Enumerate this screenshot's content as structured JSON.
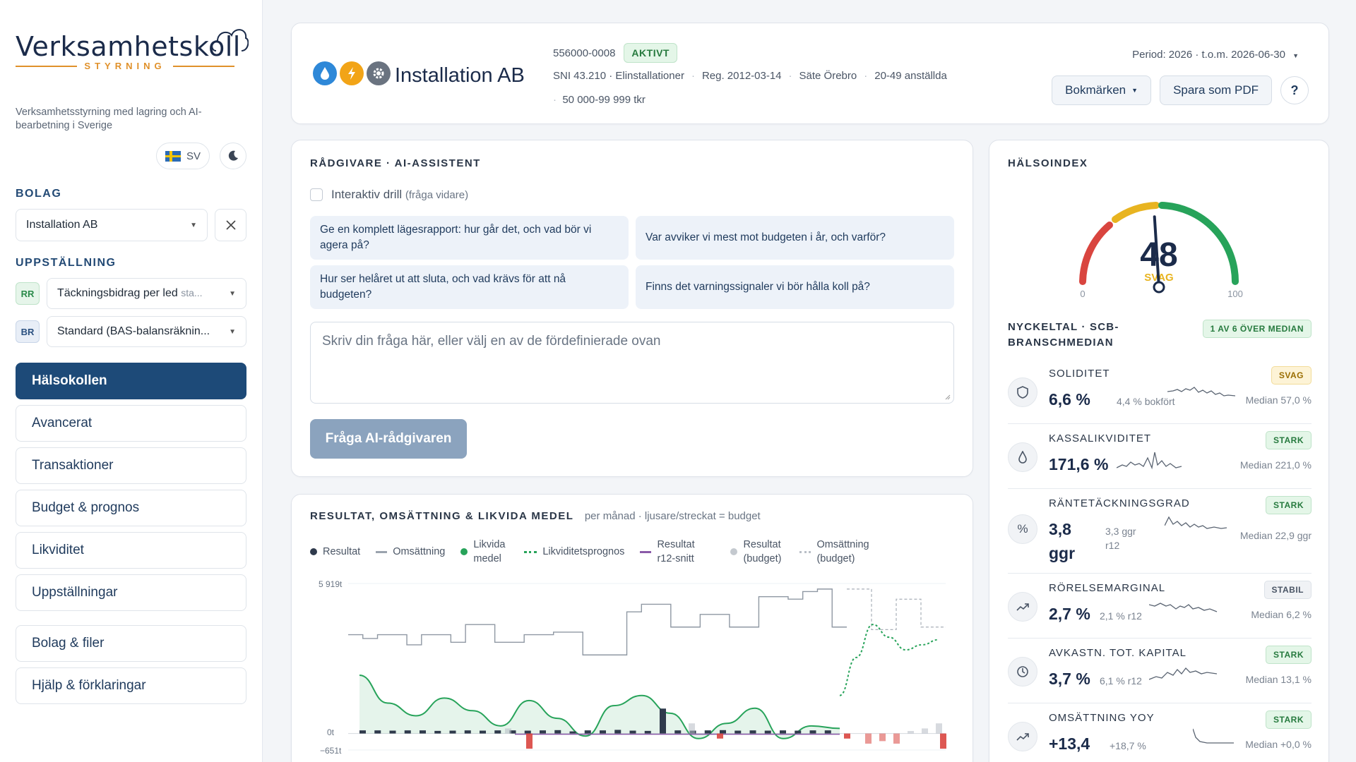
{
  "brand": {
    "name": "Verksamhetskoll",
    "sub": "STYRNING",
    "tagline": "Verksamhetsstyrning med lagring och AI-bearbetning i Sverige"
  },
  "lang": {
    "code": "SV"
  },
  "sidebar": {
    "bolag_heading": "BOLAG",
    "bolag_value": "Installation AB",
    "upp_heading": "UPPSTÄLLNING",
    "rr_tag": "RR",
    "rr_value": "Täckningsbidrag per led",
    "rr_hint": "sta...",
    "br_tag": "BR",
    "br_value": "Standard (BAS-balansräknin...",
    "nav": [
      "Hälsokollen",
      "Avancerat",
      "Transaktioner",
      "Budget & prognos",
      "Likviditet",
      "Uppställningar",
      "Bolag & filer",
      "Hjälp & förklaringar"
    ]
  },
  "header": {
    "company": "Installation AB",
    "orgnr": "556000-0008",
    "status": "AKTIVT",
    "sni": "SNI 43.210 · Elinstallationer",
    "reg": "Reg. 2012-03-14",
    "sate": "Säte Örebro",
    "anstallda": "20-49 anställda",
    "omsattning": "50 000-99 999 tkr",
    "period": "Period: 2026 · t.o.m. 2026-06-30",
    "bokmarken": "Bokmärken",
    "pdf": "Spara som PDF",
    "help": "?"
  },
  "ai": {
    "title": "RÅDGIVARE · AI-ASSISTENT",
    "drill": "Interaktiv drill",
    "drill_sub": "(fråga vidare)",
    "questions": [
      "Ge en komplett lägesrapport: hur går det, och vad bör vi agera på?",
      "Var avviker vi mest mot budgeten i år, och varför?",
      "Hur ser helåret ut att sluta, och vad krävs för att nå budgeten?",
      "Finns det varningssignaler vi bör hålla koll på?"
    ],
    "placeholder": "Skriv din fråga här, eller välj en av de fördefinierade ovan",
    "button": "Fråga AI-rådgivaren"
  },
  "chart": {
    "title": "RESULTAT, OMSÄTTNING & LIKVIDA MEDEL",
    "subtitle": "per månad · ljusare/streckat = budget",
    "legend": [
      "Resultat",
      "Omsättning",
      "Likvida medel",
      "Likviditetsprognos",
      "Resultat r12-snitt",
      "Resultat (budget)",
      "Omsättning (budget)"
    ],
    "y_top": "5 919t",
    "y_zero": "0t",
    "y_bottom": "−651t"
  },
  "chart_data": {
    "type": "line",
    "ylim": [
      -651,
      5919
    ],
    "yticks": [
      "5 919t",
      "0t",
      "−651t"
    ],
    "series": [
      {
        "name": "Omsättning",
        "values": [
          3900,
          3750,
          3900,
          3900,
          3500,
          3900,
          3900,
          3600,
          4300,
          4300,
          3600,
          3600,
          3900,
          3900,
          4000,
          4000,
          3100,
          3100,
          3100,
          4800,
          5100,
          5100,
          4200,
          4200,
          4700,
          4700,
          4200,
          4200,
          5400,
          5400,
          5300,
          5600,
          5700,
          4200
        ]
      },
      {
        "name": "Omsättning (budget)",
        "values": [
          5700,
          5700,
          4100,
          4100,
          5300,
          5300,
          4200,
          4200
        ]
      },
      {
        "name": "Likvida medel",
        "values": [
          2300,
          1200,
          700,
          1400,
          900,
          300,
          1300,
          600,
          -100,
          1100,
          1500,
          800,
          -200,
          400,
          1000,
          -200,
          300,
          200
        ]
      },
      {
        "name": "Likviditetsprognos",
        "values": [
          1500,
          3000,
          4300,
          3800,
          3300,
          3500,
          3700
        ]
      },
      {
        "name": "Resultat",
        "values": [
          40,
          40,
          30,
          40,
          40,
          20,
          30,
          40,
          30,
          40,
          40,
          30,
          40,
          50,
          0,
          40,
          40,
          60,
          30,
          20,
          900,
          40,
          30,
          40,
          50,
          30,
          40,
          30,
          40,
          30,
          40,
          40
        ]
      },
      {
        "name": "Resultat (budget)",
        "values": [
          -600,
          -200,
          -200,
          -400,
          -300,
          -400,
          100,
          200,
          400,
          200,
          400,
          -600
        ]
      }
    ]
  },
  "health": {
    "title": "HÄLSOINDEX",
    "score": "48",
    "label": "SVAG",
    "min": "0",
    "max": "100",
    "score_value": 48,
    "kpi_title": "NYCKELTAL · SCB-BRANSCHMEDIAN",
    "kpi_badge": "1 AV 6 ÖVER MEDIAN",
    "kpis": [
      {
        "name": "SOLIDITET",
        "value": "6,6 %",
        "aux": "4,4 % bokfört",
        "median": "Median 57,0 %",
        "badge": "SVAG"
      },
      {
        "name": "KASSALIKVIDITET",
        "value": "171,6 %",
        "aux": "",
        "median": "Median 221,0 %",
        "badge": "STARK"
      },
      {
        "name": "RÄNTETÄCKNINGSGRAD",
        "value": "3,8",
        "value2": "ggr",
        "aux": "3,3 ggr",
        "aux2": "r12",
        "median": "Median 22,9 ggr",
        "badge": "STARK"
      },
      {
        "name": "RÖRELSEMARGINAL",
        "value": "2,7 %",
        "aux": "2,1 % r12",
        "median": "Median 6,2 %",
        "badge": "STABIL"
      },
      {
        "name": "AVKASTN. TOT. KAPITAL",
        "value": "3,7 %",
        "aux": "6,1 % r12",
        "median": "Median 13,1 %",
        "badge": "STARK"
      },
      {
        "name": "OMSÄTTNING YOY",
        "value": "+13,4",
        "aux": "+18,7 %",
        "median": "Median +0,0 %",
        "badge": "STARK"
      }
    ]
  },
  "colors": {
    "primary": "#1d4a78",
    "green": "#27a35a",
    "red": "#d9453f",
    "yellow": "#e8b420"
  }
}
